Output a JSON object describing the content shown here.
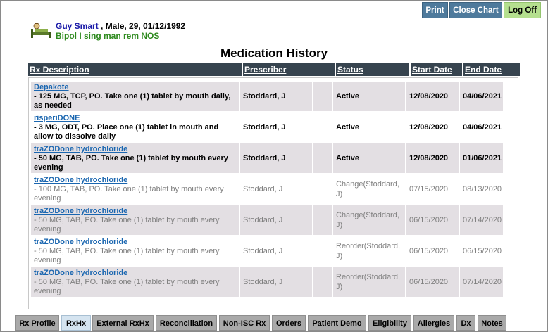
{
  "toolbar": {
    "print": "Print",
    "close_chart": "Close Chart",
    "log_off": "Log Off"
  },
  "patient": {
    "name": "Guy Smart",
    "demographics": " , Male, 29, 01/12/1992",
    "diagnosis": "Bipol I sing man rem NOS"
  },
  "page_title": "Medication History",
  "columns": {
    "description": "Rx Description",
    "prescriber": "Prescriber",
    "status": "Status",
    "start_date": "Start Date",
    "end_date": "End Date"
  },
  "rows": [
    {
      "drug": "Depakote",
      "detail": "- 125 MG, TCP, PO. Take one (1) tablet by mouth daily, as needed",
      "prescriber": "Stoddard, J",
      "status": "Active",
      "start": "12/08/2020",
      "end": "04/06/2021"
    },
    {
      "drug": "risperiDONE",
      "detail": "- 3 MG, ODT, PO. Place one (1) tablet in mouth and allow to dissolve daily",
      "prescriber": "Stoddard, J",
      "status": "Active",
      "start": "12/08/2020",
      "end": "04/06/2021"
    },
    {
      "drug": "traZODone hydrochloride",
      "detail": "- 50 MG, TAB, PO. Take one (1) tablet by mouth every evening",
      "prescriber": "Stoddard, J",
      "status": "Active",
      "start": "12/08/2020",
      "end": "01/06/2021"
    },
    {
      "drug": "traZODone hydrochloride",
      "detail": "- 100 MG, TAB, PO. Take one (1) tablet by mouth every evening",
      "prescriber": "Stoddard, J",
      "status": "Change(Stoddard, J)",
      "start": "07/15/2020",
      "end": "08/13/2020"
    },
    {
      "drug": "traZODone hydrochloride",
      "detail": "- 50 MG, TAB, PO. Take one (1) tablet by mouth every evening",
      "prescriber": "Stoddard, J",
      "status": "Change(Stoddard, J)",
      "start": "06/15/2020",
      "end": "07/14/2020"
    },
    {
      "drug": "traZODone hydrochloride",
      "detail": "- 50 MG, TAB, PO. Take one (1) tablet by mouth every evening",
      "prescriber": "Stoddard, J",
      "status": "Reorder(Stoddard, J)",
      "start": "06/15/2020",
      "end": "06/15/2020"
    },
    {
      "drug": "traZODone hydrochloride",
      "detail": "- 50 MG, TAB, PO. Take one (1) tablet by mouth every evening",
      "prescriber": "Stoddard, J",
      "status": "Reorder(Stoddard, J)",
      "start": "06/15/2020",
      "end": "07/14/2020"
    }
  ],
  "tabs": [
    "Rx Profile",
    "RxHx",
    "External RxHx",
    "Reconciliation",
    "Non-ISC Rx",
    "Orders",
    "Patient Demo",
    "Eligibility",
    "Allergies",
    "Dx",
    "Notes"
  ],
  "selected_tab": "RxHx",
  "icons": {
    "patient": "patient-bed-icon"
  },
  "colors": {
    "header_bar": "#37444f",
    "button": "#4e7a9c",
    "log_off": "#b5e08f",
    "drug_link": "#1a66b0",
    "diagnosis": "#2e8a1e",
    "name": "#1a1aa8"
  }
}
